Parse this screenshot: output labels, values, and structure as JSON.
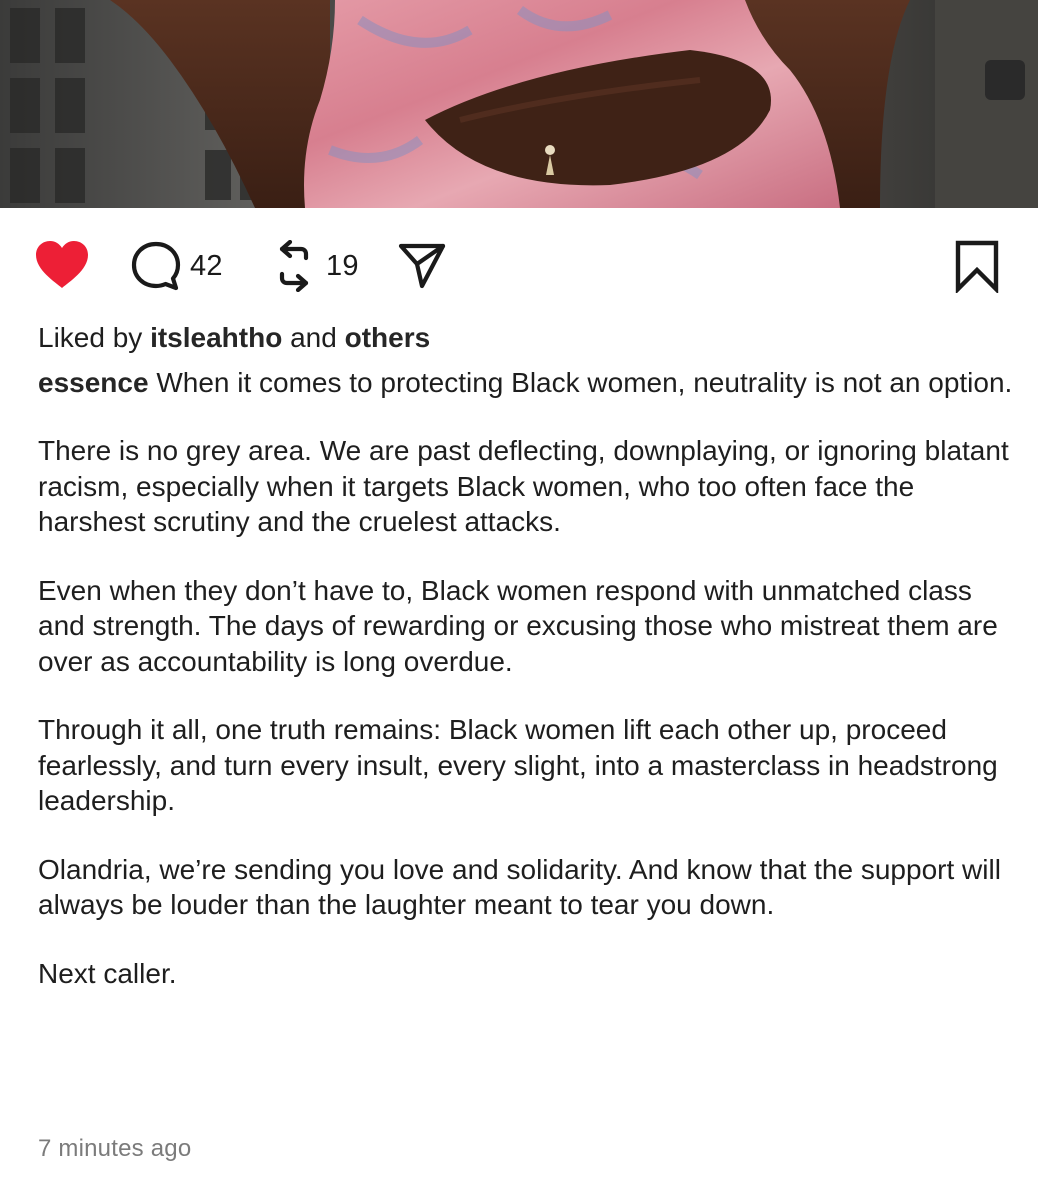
{
  "post": {
    "image_alt": "photo crop: person in pink and blue shimmering dress with navel piercing",
    "actions": {
      "like_icon": "heart-filled-icon",
      "comment_icon": "comment-bubble-icon",
      "comment_count": "42",
      "repost_icon": "repost-arrows-icon",
      "repost_count": "19",
      "share_icon": "paper-plane-icon",
      "save_icon": "bookmark-icon"
    },
    "likes": {
      "prefix": "Liked by ",
      "user": "itsleahtho",
      "middle": " and ",
      "others": "others"
    },
    "caption": {
      "username": "essence",
      "lead": " When it comes to protecting Black women, neutrality is not an option.",
      "paragraphs": [
        "There is no grey area. We are past deflecting, downplaying, or ignoring blatant racism, especially when it targets Black women, who too often face the harshest scrutiny and the cruelest attacks.",
        "Even when they don’t have to, Black women respond with unmatched class and strength. The days of rewarding or excusing those who mistreat them are over as accountability is long overdue.",
        "Through it all, one truth remains: Black women lift each other up, proceed fearlessly, and turn every insult, every slight, into a masterclass in headstrong leadership.",
        "Olandria, we’re sending you love and solidarity. And know that the support will always be louder than the laughter meant to tear you down.",
        "Next caller."
      ]
    },
    "timestamp": "7 minutes ago"
  },
  "colors": {
    "like_red": "#ed1f36",
    "icon_dark": "#1a1a1a",
    "timestamp_grey": "#7b7b7b"
  }
}
